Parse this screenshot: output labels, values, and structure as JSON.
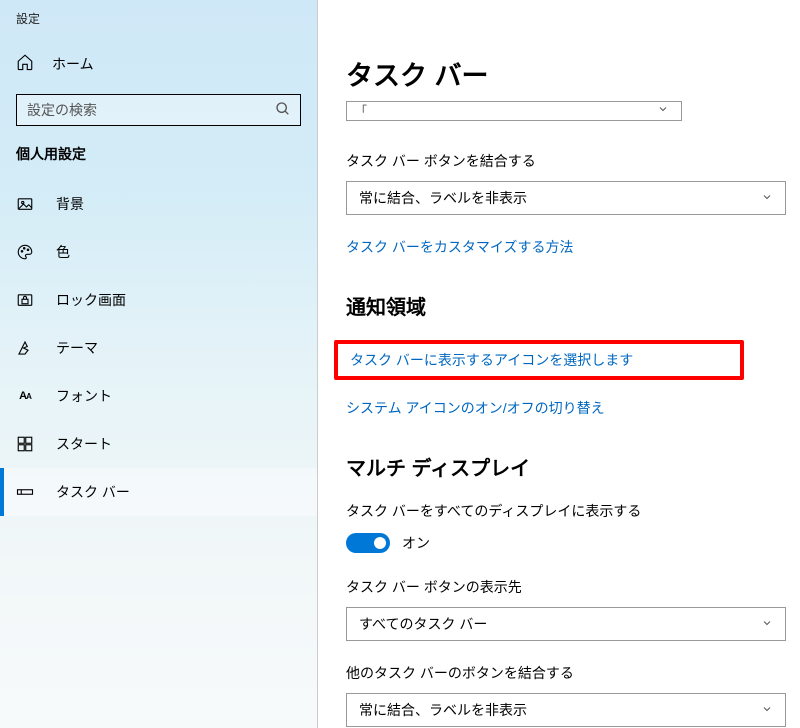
{
  "appname": "設定",
  "home": "ホーム",
  "search": {
    "placeholder": "設定の検索"
  },
  "section": "個人用設定",
  "menu": [
    {
      "label": "背景",
      "icon": "image"
    },
    {
      "label": "色",
      "icon": "palette"
    },
    {
      "label": "ロック画面",
      "icon": "lock"
    },
    {
      "label": "テーマ",
      "icon": "theme"
    },
    {
      "label": "フォント",
      "icon": "font"
    },
    {
      "label": "スタート",
      "icon": "start"
    },
    {
      "label": "タスク バー",
      "icon": "taskbar"
    }
  ],
  "title": "タスク バー",
  "partial_dd": "「",
  "combine": {
    "label": "タスク バー ボタンを結合する",
    "value": "常に結合、ラベルを非表示"
  },
  "customize_link": "タスク バーをカスタマイズする方法",
  "notif_heading": "通知領域",
  "select_icons_link": "タスク バーに表示するアイコンを選択します",
  "system_icons_link": "システム アイコンのオン/オフの切り替え",
  "multi_heading": "マルチ ディスプレイ",
  "show_all": {
    "label": "タスク バーをすべてのディスプレイに表示する",
    "state": "オン"
  },
  "show_where": {
    "label": "タスク バー ボタンの表示先",
    "value": "すべてのタスク バー"
  },
  "combine_other": {
    "label": "他のタスク バーのボタンを結合する",
    "value": "常に結合、ラベルを非表示"
  }
}
